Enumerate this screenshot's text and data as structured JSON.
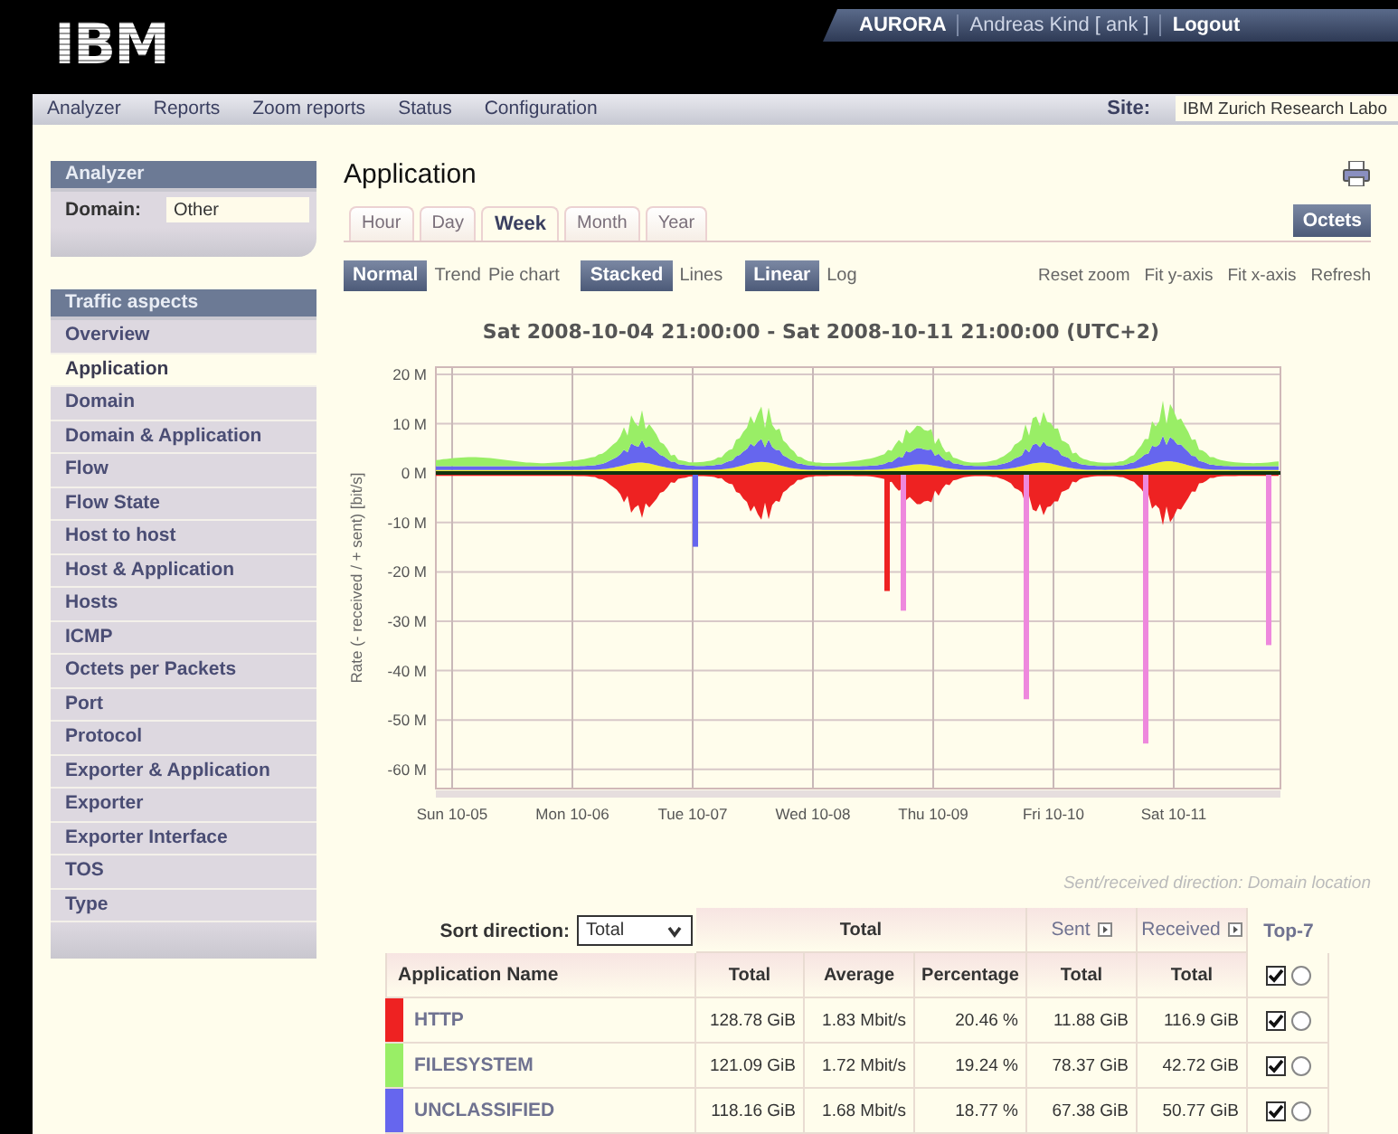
{
  "header": {
    "logo": "IBM",
    "user_bar": [
      {
        "label": "AURORA",
        "bold": true
      },
      {
        "label": "Andreas Kind [ ank ]",
        "bold": false
      },
      {
        "label": "Logout",
        "bold": true
      }
    ]
  },
  "nav": {
    "items": [
      "Analyzer",
      "Reports",
      "Zoom reports",
      "Status",
      "Configuration"
    ],
    "site_label": "Site:",
    "site_value": "IBM Zurich Research Labo"
  },
  "sidebar": {
    "analyzer_panel": {
      "title": "Analyzer",
      "domain_label": "Domain:",
      "domain_value": "Other"
    },
    "traffic_panel": {
      "title": "Traffic aspects",
      "items": [
        {
          "label": "Overview",
          "selected": false
        },
        {
          "label": "Application",
          "selected": true
        },
        {
          "label": "Domain",
          "selected": false
        },
        {
          "label": "Domain & Application",
          "selected": false
        },
        {
          "label": "Flow",
          "selected": false
        },
        {
          "label": "Flow State",
          "selected": false
        },
        {
          "label": "Host to host",
          "selected": false
        },
        {
          "label": "Host & Application",
          "selected": false
        },
        {
          "label": "Hosts",
          "selected": false
        },
        {
          "label": "ICMP",
          "selected": false
        },
        {
          "label": "Octets per Packets",
          "selected": false
        },
        {
          "label": "Port",
          "selected": false
        },
        {
          "label": "Protocol",
          "selected": false
        },
        {
          "label": "Exporter & Application",
          "selected": false
        },
        {
          "label": "Exporter",
          "selected": false
        },
        {
          "label": "Exporter Interface",
          "selected": false
        },
        {
          "label": "TOS",
          "selected": false
        },
        {
          "label": "Type",
          "selected": false
        }
      ]
    }
  },
  "main": {
    "title": "Application",
    "tabs": [
      {
        "label": "Hour",
        "selected": false
      },
      {
        "label": "Day",
        "selected": false
      },
      {
        "label": "Week",
        "selected": true
      },
      {
        "label": "Month",
        "selected": false
      },
      {
        "label": "Year",
        "selected": false
      }
    ],
    "unit_button": "Octets",
    "mode_groups": [
      [
        {
          "label": "Normal",
          "selected": true
        },
        {
          "label": "Trend",
          "selected": false
        },
        {
          "label": "Pie chart",
          "selected": false
        }
      ],
      [
        {
          "label": "Stacked",
          "selected": true
        },
        {
          "label": "Lines",
          "selected": false
        }
      ],
      [
        {
          "label": "Linear",
          "selected": true
        },
        {
          "label": "Log",
          "selected": false
        }
      ]
    ],
    "actions": [
      "Reset zoom",
      "Fit y-axis",
      "Fit x-axis",
      "Refresh"
    ],
    "chart": {
      "title": "Sat 2008-10-04 21:00:00 - Sat 2008-10-11 21:00:00 (UTC+2)",
      "y_axis_label": "Rate (- received / + sent) [bit/s]",
      "y_ticks": [
        "20 M",
        "10 M",
        "0 M",
        "-10 M",
        "-20 M",
        "-30 M",
        "-40 M",
        "-50 M",
        "-60 M"
      ],
      "x_ticks": [
        "Sun 10-05",
        "Mon 10-06",
        "Tue 10-07",
        "Wed 10-08",
        "Thu 10-09",
        "Fri 10-10",
        "Sat 10-11"
      ]
    },
    "direction_note": "Sent/received direction: Domain location",
    "table": {
      "sort_label": "Sort direction:",
      "sort_value": "Total",
      "group_headers": [
        {
          "label": "Total",
          "link": false
        },
        {
          "label": "Sent",
          "link": true
        },
        {
          "label": "Received",
          "link": true
        }
      ],
      "top_label": "Top-7",
      "top_checked": true,
      "top_radio": false,
      "columns": [
        "Application Name",
        "Total",
        "Average",
        "Percentage",
        "Total",
        "Total"
      ],
      "rows": [
        {
          "color": "#ee2222",
          "cells": [
            "HTTP",
            "128.78 GiB",
            "1.83 Mbit/s",
            "20.46 %",
            "11.88 GiB",
            "116.9 GiB"
          ],
          "checked": true,
          "selected": false
        },
        {
          "color": "#99ee66",
          "cells": [
            "FILESYSTEM",
            "121.09 GiB",
            "1.72 Mbit/s",
            "19.24 %",
            "78.37 GiB",
            "42.72 GiB"
          ],
          "checked": true,
          "selected": false
        },
        {
          "color": "#6666ee",
          "cells": [
            "UNCLASSIFIED",
            "118.16 GiB",
            "1.68 Mbit/s",
            "18.77 %",
            "67.38 GiB",
            "50.77 GiB"
          ],
          "checked": true,
          "selected": false
        }
      ]
    }
  }
}
